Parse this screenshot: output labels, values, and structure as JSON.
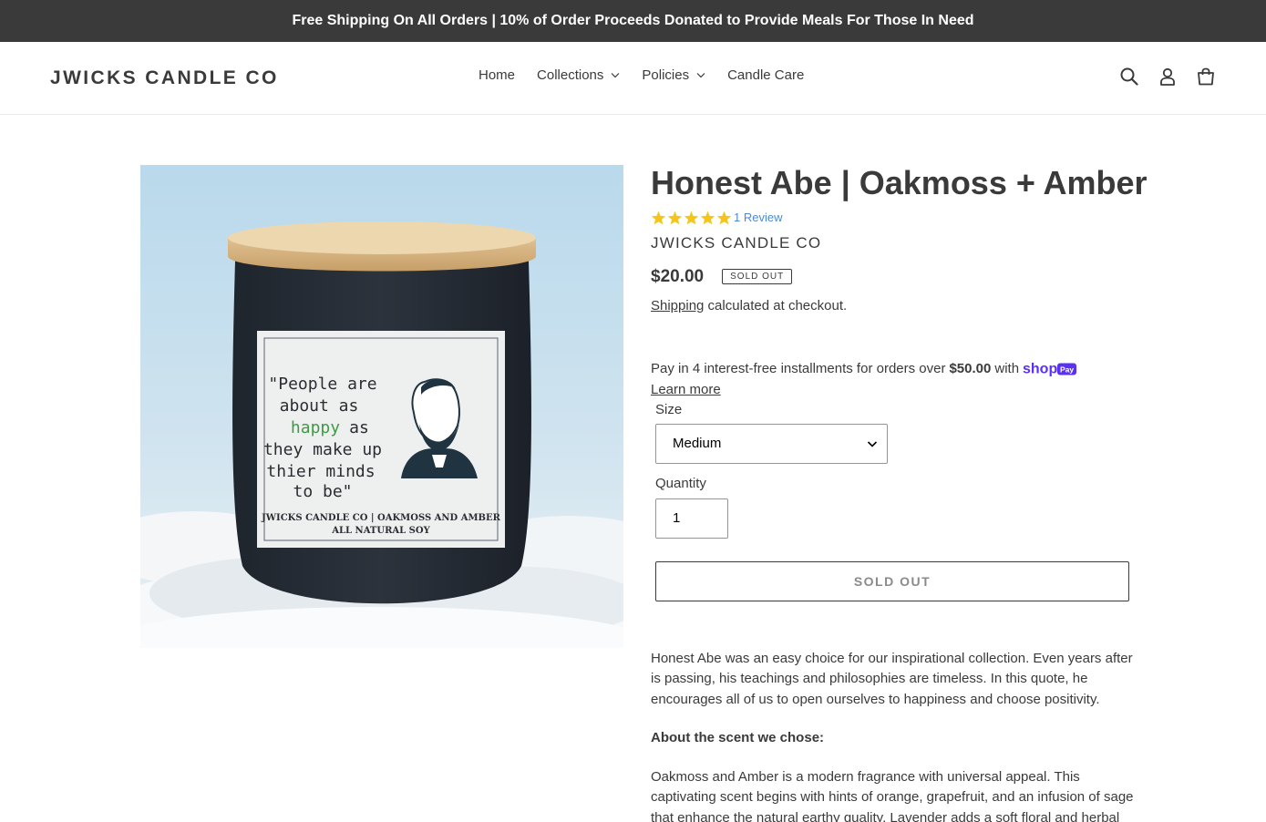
{
  "announcement": {
    "text": "Free Shipping On All Orders | 10% of Order Proceeds Donated to Provide Meals For Those In Need"
  },
  "header": {
    "logo": "JWICKS CANDLE CO",
    "nav": {
      "home": "Home",
      "collections": "Collections",
      "policies": "Policies",
      "candle_care": "Candle Care"
    },
    "icons": [
      "search-icon",
      "account-icon",
      "cart-icon"
    ]
  },
  "product": {
    "image_text": {
      "quote_line1": "\"People are",
      "quote_line2": "about as",
      "quote_line3": "happy",
      "quote_line3b": "as",
      "quote_line4": "they make up",
      "quote_line5": "thier minds",
      "quote_line6": "to be\"",
      "brand_line": "JWICKS CANDLE CO | OAKMOSS AND AMBER",
      "sub_line": "ALL NATURAL SOY"
    },
    "title": "Honest Abe | Oakmoss + Amber",
    "rating": {
      "stars": 5,
      "review_text": "1 Review"
    },
    "vendor": "JWICKS CANDLE CO",
    "price": "$20.00",
    "badge": "Sold out",
    "tax": {
      "link": "Shipping",
      "text": " calculated at checkout."
    },
    "shop_pay": {
      "text_before": "Pay in 4 interest-free installments for orders over",
      "amount": "$50.00",
      "text_after": "with",
      "logo_text": "shop",
      "logo_badge": "Pay",
      "learn_more": "Learn more"
    },
    "size": {
      "label": "Size",
      "selected": "Medium"
    },
    "quantity": {
      "label": "Quantity",
      "value": "1"
    },
    "button": "SOLD OUT",
    "description": {
      "p1": "Honest Abe was an easy choice for our inspirational collection. Even years after is passing, his teachings and philosophies are timeless. In this quote, he encourages all of us to open ourselves to happiness and choose positivity.",
      "heading": "About the scent we chose:",
      "p2": "Oakmoss and Amber is a modern fragrance with universal appeal. This captivating scent begins with hints of orange, grapefruit, and an infusion of sage that enhance the natural earthy quality. Lavender adds a soft floral and herbal"
    }
  },
  "colors": {
    "text": "#3a3a3a",
    "announcement_bg": "#3a3a3a",
    "star": "#f5c518",
    "link": "#4d8ad1",
    "shop_pay": "#5a31f4"
  }
}
